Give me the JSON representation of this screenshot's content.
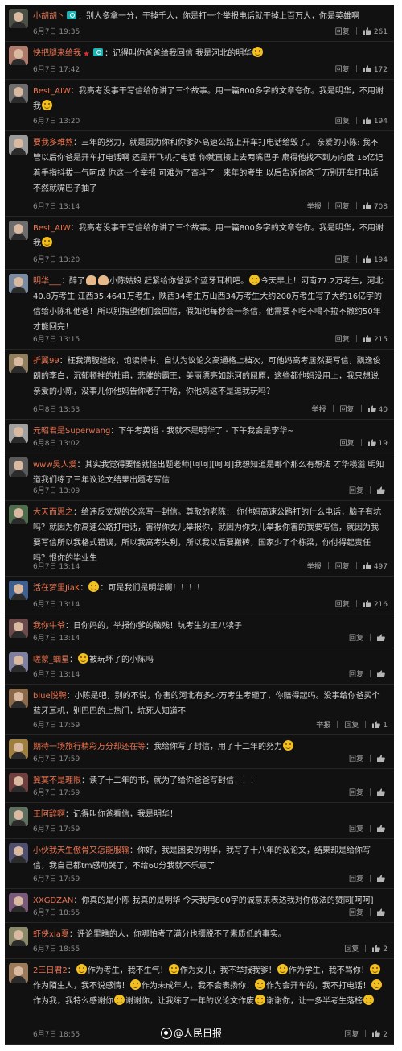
{
  "actions": {
    "report": "举报",
    "reply": "回复"
  },
  "watermark": "@人民日报",
  "comments": [
    {
      "user": "小胡胡丶",
      "segments": [
        {
          "t": "text",
          "v": "别人多拿一分，干掉千人，你是打一个举报电话就干掉上百万人，你是英雄啊"
        }
      ],
      "time": "6月7日 19:35",
      "likes": "261",
      "report": false,
      "badges": [
        "cam"
      ],
      "avatar": "#4a4f46"
    },
    {
      "user": "快把腿来给我",
      "segments": [
        {
          "t": "text",
          "v": "记得叫你爸爸给我回信 我是河北的明华"
        },
        {
          "t": "emo"
        }
      ],
      "time": "6月7日 17:42",
      "likes": "172",
      "report": false,
      "badges": [
        "red",
        "cam"
      ],
      "avatar": "#b07a6a"
    },
    {
      "user": "Best_AIW",
      "segments": [
        {
          "t": "text",
          "v": "我高考没事干写信给你讲了三个故事。用一篇800多字的文章夸你。我是明华，不用谢我"
        },
        {
          "t": "emo"
        }
      ],
      "time": "6月7日 13:20",
      "likes": "194",
      "report": false,
      "badges": [],
      "avatar": "#6d6d6d"
    },
    {
      "user": "要我多难熬",
      "segments": [
        {
          "t": "text",
          "v": "三年的努力，就是因为你和你爹外高速公路上开车打电话给毁了。 亲爱的小陈: 我不管以后你爸是开车打电话啊 还是开飞机打电话 你就直接上去两嘴巴子 扇得他找不到方向盘 16亿记着手指抖拔一气呵成 你这一个举报 可难为了奋斗了十来年的考生 以后告诉你爸千万别开车打电话 不然就嘴巴子抽了"
        }
      ],
      "time": "6月7日 13:14",
      "likes": "708",
      "report": true,
      "badges": [],
      "avatar": "#9a9a9a"
    },
    {
      "user": "Best_AIW",
      "segments": [
        {
          "t": "text",
          "v": "我高考没事干写信给你讲了三个故事。用一篇800多字的文章夸你。我是明华，不用谢我"
        },
        {
          "t": "emo"
        }
      ],
      "time": "6月7日 13:20",
      "likes": "194",
      "report": false,
      "badges": [],
      "avatar": "#6d6d6d"
    },
    {
      "user": "明华___",
      "segments": [
        {
          "t": "text",
          "v": "醉了"
        },
        {
          "t": "hand"
        },
        {
          "t": "hand"
        },
        {
          "t": "text",
          "v": "小陈姑娘 赶紧给你爸买个蓝牙耳机吧。"
        },
        {
          "t": "emo"
        },
        {
          "t": "text",
          "v": "今天早上！河南77.2万考生，河北40.8万考生 江西35.4641万考生，陕西34考生万山西34万考生大约200万考生写了大约16亿字的信给小陈和他爸！所以别指望他们会回信，假如他每秒会一条信，他需要不吃不喝不拉不撒约50年才能回完！"
        }
      ],
      "time": "6月7日 13:15",
      "likes": "215",
      "report": false,
      "badges": [],
      "avatar": "#7a8aa0"
    },
    {
      "user": "折翼99",
      "segments": [
        {
          "t": "text",
          "v": "枉我满腹经纶，饱读诗书，自认为议论文高通格上档次，可他妈高考居然要写信，飘逸俊朗的李白，沉郁顿挫的杜甫，悲催的霸王，美丽漂亮如跳河的屈原，这些都他妈没用上，我只想说亲爱的小陈，没事儿你他妈告你老子干啥，你他妈这不是逗我玩吗？"
        }
      ],
      "time": "6月8日 13:53",
      "likes": "40",
      "report": true,
      "badges": [],
      "avatar": "#8f7f5f"
    },
    {
      "user": "元昭君是Superwang",
      "segments": [
        {
          "t": "text",
          "v": "下午考英语 - 我就不是明华了 - 下午我会是李华~"
        }
      ],
      "time": "6月8日 13:02",
      "likes": "19",
      "report": false,
      "badges": [],
      "avatar": "#a0a0a0"
    },
    {
      "user": "www吴人爱",
      "segments": [
        {
          "t": "text",
          "v": "其实我觉得要怪就怪出题老师[呵呵][呵呵]我想知道是哪个那么有想法 才华横溢 明知道我们练了三年议论文结果出题考写信"
        }
      ],
      "time": "6月7日 13:09",
      "likes": "",
      "report": false,
      "badges": [],
      "avatar": "#5a5a5a"
    },
    {
      "user": "大天而思之",
      "segments": [
        {
          "t": "text",
          "v": "给违反交规的父亲写一封信。尊敬的老陈： 你他妈高速公路打的什么电话，脑子有坑吗？就因为你高速公路打电话，害得你女儿举报你，就因为你女儿举报你害的我要写信，就因为我要写信所以我格式错误，所以我高考失利，所以我以后要搬砖，国家少了个栋梁，你付得起责任吗？恨你的毕业生"
        }
      ],
      "time": "6月7日 13:14",
      "likes": "497",
      "report": true,
      "badges": [],
      "avatar": "#4d6d4d"
    },
    {
      "user": "活在梦里JiaK",
      "segments": [
        {
          "t": "emo"
        },
        {
          "t": "text",
          "v": "：可是我们是明华啊！！！！"
        }
      ],
      "time": "6月7日 13:14",
      "likes": "216",
      "report": false,
      "badges": [],
      "avatar": "#3f5f8f"
    },
    {
      "user": "我你牛爷",
      "segments": [
        {
          "t": "text",
          "v": "日你妈的，举报你爹的脑残！坑考生的王八犊子"
        }
      ],
      "time": "6月7日 13:14",
      "likes": "",
      "report": false,
      "badges": [],
      "avatar": "#6a4a4a"
    },
    {
      "user": "嗟蒙_蝈星",
      "segments": [
        {
          "t": "emo"
        },
        {
          "t": "text",
          "v": "被玩坏了的小陈吗"
        }
      ],
      "time": "6月7日 13:14",
      "likes": "",
      "report": false,
      "badges": [],
      "avatar": "#7f7f9f"
    },
    {
      "user": "blue悦聘",
      "segments": [
        {
          "t": "text",
          "v": "小陈是吧，别的不说，你害的河北有多少万考生考砸了，你赔得起吗。没事给你爸买个蓝牙耳机，别巴巴的上热门，坑死人知道不"
        }
      ],
      "time": "6月7日 17:59",
      "likes": "1",
      "report": true,
      "badges": [],
      "avatar": "#8a6a4a"
    },
    {
      "user": "期待一场旅行精彩万分却还在等",
      "segments": [
        {
          "t": "text",
          "v": "我给你写了封信，用了十二年的努力"
        },
        {
          "t": "emo"
        }
      ],
      "time": "6月7日 17:59",
      "likes": "",
      "report": false,
      "badges": [],
      "avatar": "#9f7f3f"
    },
    {
      "user": "冀寞不是理限",
      "segments": [
        {
          "t": "text",
          "v": "读了十二年的书，就为了给你爸爸写封信！！！"
        }
      ],
      "time": "6月7日 17:59",
      "likes": "",
      "report": false,
      "badges": [],
      "avatar": "#6f3f3f"
    },
    {
      "user": "王阿辞啊",
      "segments": [
        {
          "t": "text",
          "v": "记得叫你爸看信，我是明华！"
        }
      ],
      "time": "6月7日 17:59",
      "likes": "",
      "report": false,
      "badges": [],
      "avatar": "#5f6f5f"
    },
    {
      "user": "小伙我天生傲骨又怎能服输",
      "segments": [
        {
          "t": "text",
          "v": "你好，我是困安的明华，我写了十八年的议论文，结果却是给你写信，我自己都tm感动哭了，不给60分我就不乐意了"
        }
      ],
      "time": "6月7日 17:59",
      "likes": "",
      "report": false,
      "badges": [],
      "avatar": "#4f4f6f"
    },
    {
      "user": "XXGDZAN",
      "segments": [
        {
          "t": "text",
          "v": "你真的是小陈 我真的是明华 今天我用800字的诚意来表达我对你做法的赞同[呵呵]"
        }
      ],
      "time": "6月7日 18:55",
      "likes": "",
      "report": false,
      "badges": [],
      "avatar": "#7a5a7a"
    },
    {
      "user": "虾侠xia夏",
      "segments": [
        {
          "t": "text",
          "v": "评论里瞧的人，你哪怕考了满分也摆脱不了素质低的事实。"
        }
      ],
      "time": "6月7日 18:55",
      "likes": "2",
      "report": false,
      "badges": [],
      "avatar": "#8a8a6a"
    },
    {
      "user": "2三日君2",
      "segments": [
        {
          "t": "emo"
        },
        {
          "t": "text",
          "v": "作为考生，我不生气！"
        },
        {
          "t": "emo"
        },
        {
          "t": "text",
          "v": "作为女儿，我不举报我爹！"
        },
        {
          "t": "emo"
        },
        {
          "t": "text",
          "v": "作为学生，我不骂你！"
        },
        {
          "t": "emo"
        },
        {
          "t": "text",
          "v": "作为陌生人，我不说感情！"
        },
        {
          "t": "emo"
        },
        {
          "t": "text",
          "v": "作为未成年人，我不会表扬你！"
        },
        {
          "t": "emo"
        },
        {
          "t": "text",
          "v": "作为会开车的，我不打电话！"
        },
        {
          "t": "emo"
        },
        {
          "t": "text",
          "v": "作为我，我特么感谢你"
        },
        {
          "t": "emo"
        },
        {
          "t": "text",
          "v": "谢谢你，让我练了一年的议论文作废"
        },
        {
          "t": "emo"
        },
        {
          "t": "text",
          "v": "谢谢你，让一多半考生落榜"
        },
        {
          "t": "emo"
        }
      ],
      "time": "6月7日 18:55",
      "likes": "2",
      "report": false,
      "badges": [],
      "avatar": "#9a7a5a"
    }
  ]
}
